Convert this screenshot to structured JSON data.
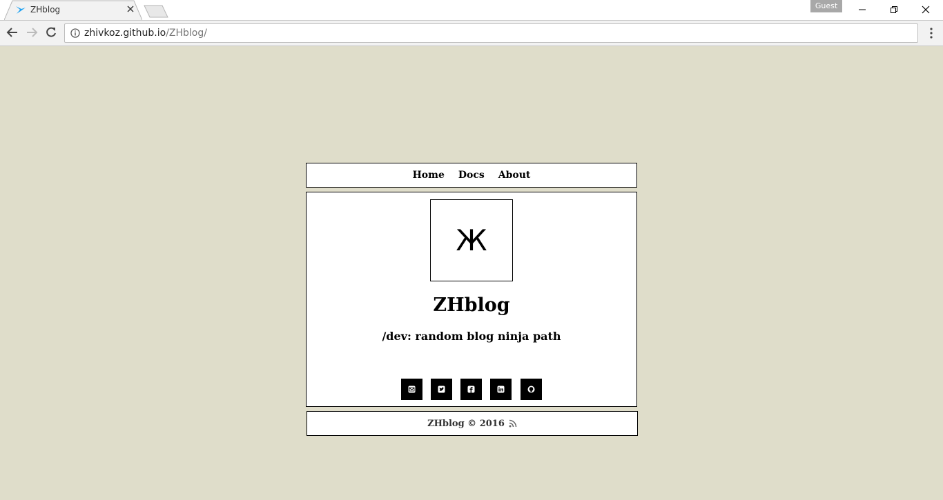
{
  "browser": {
    "tab_title": "ZHblog",
    "profile_label": "Guest",
    "url_domain": "zhivkoz.github.io",
    "url_path": "/ZHblog/"
  },
  "nav": {
    "items": [
      {
        "label": "Home"
      },
      {
        "label": "Docs"
      },
      {
        "label": "About"
      }
    ]
  },
  "hero": {
    "logo_glyph": "Ж",
    "title": "ZHblog",
    "subtitle": "/dev: random blog ninja path"
  },
  "social": {
    "icons": [
      "email-icon",
      "twitter-icon",
      "facebook-icon",
      "linkedin-icon",
      "github-icon"
    ]
  },
  "footer": {
    "copyright": "ZHblog © 2016",
    "feed_icon": "rss-icon"
  },
  "colors": {
    "page_background": "#dfddca",
    "box_background": "#ffffff",
    "border": "#000000",
    "favicon": "#1da1f2"
  }
}
